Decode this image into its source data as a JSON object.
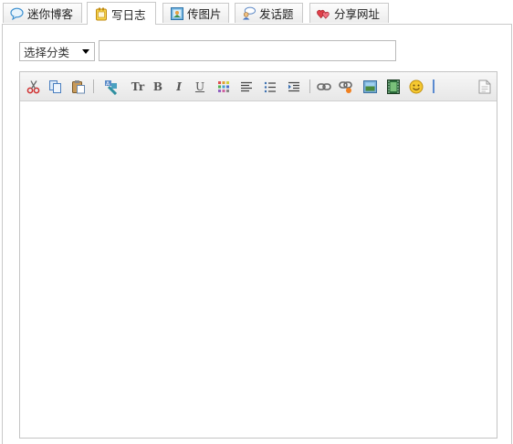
{
  "tabs": [
    {
      "label": "迷你博客",
      "icon": "speech-bubble-icon",
      "active": false
    },
    {
      "label": "写日志",
      "icon": "notepad-icon",
      "active": true
    },
    {
      "label": "传图片",
      "icon": "picture-icon",
      "active": false
    },
    {
      "label": "发话题",
      "icon": "discussion-icon",
      "active": false
    },
    {
      "label": "分享网址",
      "icon": "hearts-icon",
      "active": false
    }
  ],
  "form": {
    "category_selected": "选择分类",
    "title_value": ""
  },
  "toolbar": {
    "buttons": [
      "cut-icon",
      "copy-icon",
      "paste-icon",
      "format-painter-icon",
      "font-size-icon",
      "bold-icon",
      "italic-icon",
      "underline-icon",
      "color-palette-icon",
      "align-left-icon",
      "bullet-list-icon",
      "indent-icon",
      "link-icon",
      "unlink-icon",
      "image-icon",
      "video-icon",
      "emoticon-icon",
      "source-view-icon"
    ],
    "font_size_text": "Tr",
    "bold_text": "B",
    "italic_text": "I",
    "underline_text": "U"
  },
  "editor": {
    "content": ""
  }
}
